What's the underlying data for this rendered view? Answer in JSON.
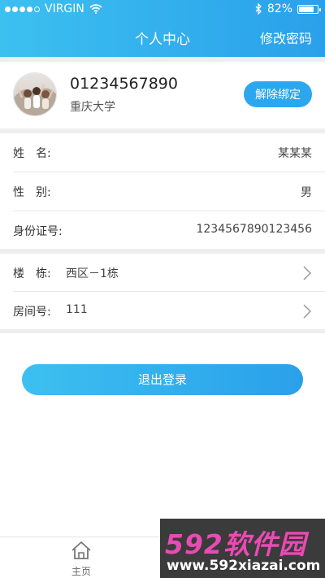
{
  "status_bar": {
    "carrier": "VIRGIN",
    "battery_text": "82%",
    "battery_level": 0.82
  },
  "nav": {
    "title": "个人中心",
    "right_action": "修改密码"
  },
  "profile": {
    "phone": "01234567890",
    "school": "重庆大学",
    "unbind_label": "解除绑定"
  },
  "info": {
    "name": {
      "label": "姓　名:",
      "value": "某某某"
    },
    "gender": {
      "label": "性　别:",
      "value": "男"
    },
    "id_number": {
      "label": "身份证号:",
      "value": "1234567890123456"
    }
  },
  "dorm": {
    "building": {
      "label": "楼　栋:",
      "value": "西区－1栋"
    },
    "room": {
      "label": "房间号:",
      "value": "111"
    }
  },
  "logout_label": "退出登录",
  "tabbar": {
    "home_label": "主页"
  },
  "watermark": {
    "logo": "592软件园",
    "url": "www.592xiazai.com"
  },
  "colors": {
    "accent": "#2ba7ef",
    "gradient_start": "#3cc0f0",
    "section_gap": "#eeeeee"
  }
}
